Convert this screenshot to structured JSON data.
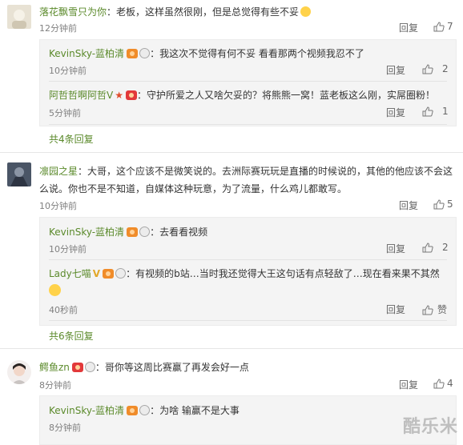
{
  "watermark": "酷乐米",
  "c1": {
    "name": "落花飘雪只为你",
    "text": "老板，这样虽然很刚，但是总觉得有些不妥",
    "time": "12分钟前",
    "reply": "回复",
    "likes": "7",
    "replies": [
      {
        "name": "KevinSky-蓝柏清",
        "text": "我这次不觉得有何不妥 看看那两个视频我忍不了",
        "time": "10分钟前",
        "reply": "回复",
        "likes": "2"
      },
      {
        "name": "阿哲哲啊阿哲V",
        "text": "守护所爱之人又啥欠妥的？将熊熊一窝！蓝老板这么刚，实屌圈粉！",
        "time": "5分钟前",
        "reply": "回复",
        "likes": "1"
      }
    ],
    "more": "共4条回复"
  },
  "c2": {
    "name": "凛园之星",
    "text1": "大哥，这个应该不是微笑说的。去洲际赛玩玩是直播的时候说的，其他的他应该不会这",
    "text2": "么说。你也不是不知道，自媒体这种玩意，为了流量，什么鸡儿都敢写。",
    "time": "10分钟前",
    "reply": "回复",
    "likes": "5",
    "replies": [
      {
        "name": "KevinSky-蓝柏清",
        "text": "去看看视频",
        "time": "10分钟前",
        "reply": "回复",
        "likes": "2"
      },
      {
        "name": "Lady七喵",
        "text": "有视频的b站…当时我还觉得大王这句话有点轻敌了…现在看来果不其然",
        "time": "40秒前",
        "reply": "回复",
        "likes": "赞"
      }
    ],
    "more": "共6条回复"
  },
  "c3": {
    "name": "鳄鱼zn",
    "text": "哥你等这周比赛赢了再发会好一点",
    "time": "8分钟前",
    "reply": "回复",
    "likes": "4",
    "replies": [
      {
        "name": "KevinSky-蓝柏清",
        "text": "为啥 输赢不是大事",
        "time": "8分钟前"
      }
    ]
  }
}
